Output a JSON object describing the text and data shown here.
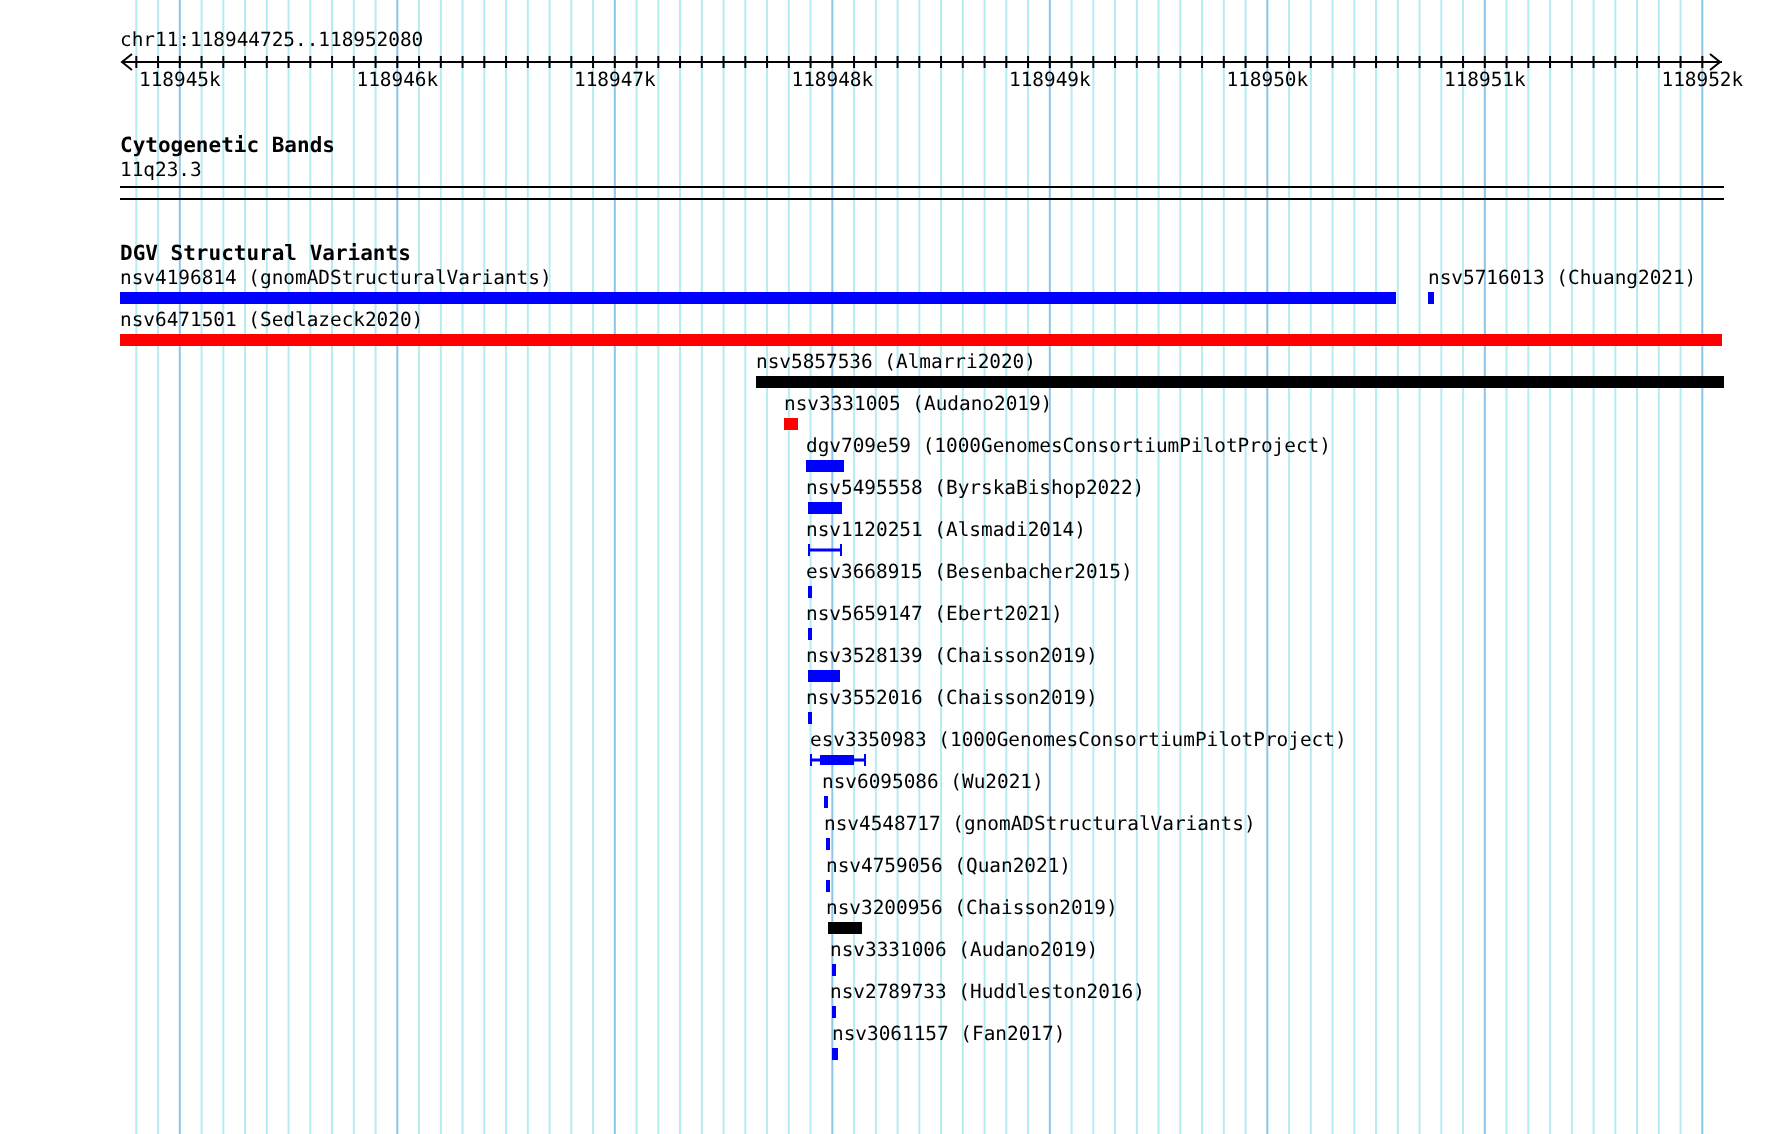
{
  "ruler": {
    "location": "chr11:118944725..118952080",
    "labels": [
      "118945k",
      "118946k",
      "118947k",
      "118948k",
      "118949k",
      "118950k",
      "118951k",
      "118952k"
    ]
  },
  "tracks": [
    {
      "kind": "bands",
      "title": "Cytogenetic Bands",
      "band": "11q23.3"
    },
    {
      "kind": "variants",
      "title": "DGV Structural Variants",
      "features": [
        {
          "label": "nsv4196814 (gnomADStructuralVariants)",
          "color": "#0000ff",
          "kind": "bar"
        },
        {
          "label": "nsv5716013 (Chuang2021)",
          "color": "#0000ff",
          "kind": "bar"
        },
        {
          "label": "nsv6471501 (Sedlazeck2020)",
          "color": "#ff0000",
          "kind": "bar"
        },
        {
          "label": "nsv5857536 (Almarri2020)",
          "color": "#000000",
          "kind": "bar"
        },
        {
          "label": "nsv3331005 (Audano2019)",
          "color": "#ff0000",
          "kind": "bar"
        },
        {
          "label": "dgv709e59 (1000GenomesConsortiumPilotProject)",
          "color": "#0000ff",
          "kind": "bar"
        },
        {
          "label": "nsv5495558 (ByrskaBishop2022)",
          "color": "#0000ff",
          "kind": "bar"
        },
        {
          "label": "nsv1120251 (Alsmadi2014)",
          "color": "#0000ff",
          "kind": "interval"
        },
        {
          "label": "esv3668915 (Besenbacher2015)",
          "color": "#0000ff",
          "kind": "bar"
        },
        {
          "label": "nsv5659147 (Ebert2021)",
          "color": "#0000ff",
          "kind": "bar"
        },
        {
          "label": "nsv3528139 (Chaisson2019)",
          "color": "#0000ff",
          "kind": "bar"
        },
        {
          "label": "nsv3552016 (Chaisson2019)",
          "color": "#0000ff",
          "kind": "bar"
        },
        {
          "label": "esv3350983 (1000GenomesConsortiumPilotProject)",
          "color": "#0000ff",
          "kind": "interval"
        },
        {
          "label": "nsv6095086 (Wu2021)",
          "color": "#0000ff",
          "kind": "bar"
        },
        {
          "label": "nsv4548717 (gnomADStructuralVariants)",
          "color": "#0000ff",
          "kind": "bar"
        },
        {
          "label": "nsv4759056 (Quan2021)",
          "color": "#0000ff",
          "kind": "bar"
        },
        {
          "label": "nsv3200956 (Chaisson2019)",
          "color": "#000000",
          "kind": "bar"
        },
        {
          "label": "nsv3331006 (Audano2019)",
          "color": "#0000ff",
          "kind": "bar"
        },
        {
          "label": "nsv2789733 (Huddleston2016)",
          "color": "#0000ff",
          "kind": "bar"
        },
        {
          "label": "nsv3061157 (Fan2017)",
          "color": "#0000ff",
          "kind": "bar"
        }
      ]
    }
  ]
}
